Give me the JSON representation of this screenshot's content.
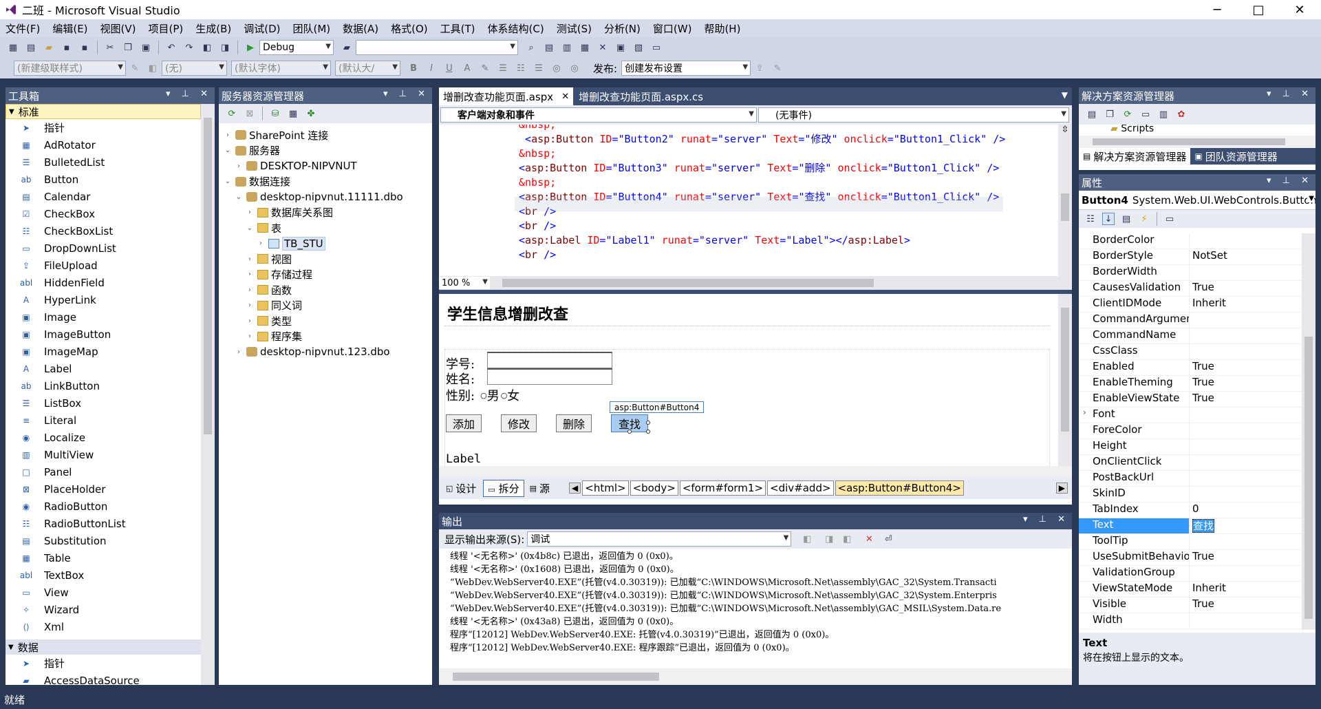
{
  "title": "二班 - Microsoft Visual Studio",
  "window_controls": {
    "minimize": "─",
    "maximize": "□",
    "close": "✕"
  },
  "menu": [
    "文件(F)",
    "编辑(E)",
    "视图(V)",
    "项目(P)",
    "生成(B)",
    "调试(D)",
    "团队(M)",
    "数据(A)",
    "格式(O)",
    "工具(T)",
    "体系结构(C)",
    "测试(S)",
    "分析(N)",
    "窗口(W)",
    "帮助(H)"
  ],
  "toolbar1": {
    "config": "Debug"
  },
  "toolbar2": {
    "style": "(新建级联样式)",
    "block": "(无)",
    "font": "(默认字体)",
    "size": "(默认大/",
    "bold": "B",
    "italic": "I",
    "underline": "U",
    "publish_label": "发布:",
    "publish": "创建发布设置"
  },
  "toolbox": {
    "title": "工具箱",
    "group_standard": "标准",
    "items": [
      {
        "icon": "pointer-icon",
        "glyph": "➤",
        "label": "指针"
      },
      {
        "icon": "adrotator-icon",
        "glyph": "▦",
        "label": "AdRotator"
      },
      {
        "icon": "bulletedlist-icon",
        "glyph": "☰",
        "label": "BulletedList"
      },
      {
        "icon": "button-icon",
        "glyph": "ab",
        "label": "Button"
      },
      {
        "icon": "calendar-icon",
        "glyph": "▤",
        "label": "Calendar"
      },
      {
        "icon": "checkbox-icon",
        "glyph": "☑",
        "label": "CheckBox"
      },
      {
        "icon": "checkboxlist-icon",
        "glyph": "☷",
        "label": "CheckBoxList"
      },
      {
        "icon": "dropdownlist-icon",
        "glyph": "▭",
        "label": "DropDownList"
      },
      {
        "icon": "fileupload-icon",
        "glyph": "⇪",
        "label": "FileUpload"
      },
      {
        "icon": "hiddenfield-icon",
        "glyph": "abl",
        "label": "HiddenField"
      },
      {
        "icon": "hyperlink-icon",
        "glyph": "A",
        "label": "HyperLink"
      },
      {
        "icon": "image-icon",
        "glyph": "▣",
        "label": "Image"
      },
      {
        "icon": "imagebutton-icon",
        "glyph": "▣",
        "label": "ImageButton"
      },
      {
        "icon": "imagemap-icon",
        "glyph": "▣",
        "label": "ImageMap"
      },
      {
        "icon": "label-icon",
        "glyph": "A",
        "label": "Label"
      },
      {
        "icon": "linkbutton-icon",
        "glyph": "ab",
        "label": "LinkButton"
      },
      {
        "icon": "listbox-icon",
        "glyph": "☰",
        "label": "ListBox"
      },
      {
        "icon": "literal-icon",
        "glyph": "≡",
        "label": "Literal"
      },
      {
        "icon": "localize-icon",
        "glyph": "◉",
        "label": "Localize"
      },
      {
        "icon": "multiview-icon",
        "glyph": "▥",
        "label": "MultiView"
      },
      {
        "icon": "panel-icon",
        "glyph": "□",
        "label": "Panel"
      },
      {
        "icon": "placeholder-icon",
        "glyph": "⊠",
        "label": "PlaceHolder"
      },
      {
        "icon": "radiobutton-icon",
        "glyph": "◉",
        "label": "RadioButton"
      },
      {
        "icon": "radiobuttonlist-icon",
        "glyph": "☷",
        "label": "RadioButtonList"
      },
      {
        "icon": "substitution-icon",
        "glyph": "▤",
        "label": "Substitution"
      },
      {
        "icon": "table-icon",
        "glyph": "▦",
        "label": "Table"
      },
      {
        "icon": "textbox-icon",
        "glyph": "abl",
        "label": "TextBox"
      },
      {
        "icon": "view-icon",
        "glyph": "▭",
        "label": "View"
      },
      {
        "icon": "wizard-icon",
        "glyph": "✧",
        "label": "Wizard"
      },
      {
        "icon": "xml-icon",
        "glyph": "⟨⟩",
        "label": "Xml"
      }
    ],
    "group_data": "数据",
    "data_items": [
      {
        "icon": "pointer-icon",
        "glyph": "➤",
        "label": "指针"
      },
      {
        "icon": "accessdatasource-icon",
        "glyph": "▰",
        "label": "AccessDataSource"
      }
    ]
  },
  "server_explorer": {
    "title": "服务器资源管理器",
    "nodes": [
      {
        "indent": 0,
        "exp": "›",
        "icon": "sharepoint-icon",
        "label": "SharePoint 连接"
      },
      {
        "indent": 0,
        "exp": "⌄",
        "icon": "server-icon",
        "label": "服务器"
      },
      {
        "indent": 1,
        "exp": "›",
        "icon": "computer-icon",
        "label": "DESKTOP-NIPVNUT"
      },
      {
        "indent": 0,
        "exp": "⌄",
        "icon": "dataconnection-icon",
        "label": "数据连接"
      },
      {
        "indent": 1,
        "exp": "⌄",
        "icon": "database-icon",
        "label": "desktop-nipvnut.11111.dbo"
      },
      {
        "indent": 2,
        "exp": "›",
        "icon": "folder-icon",
        "label": "数据库关系图"
      },
      {
        "indent": 2,
        "exp": "⌄",
        "icon": "folder-icon",
        "label": "表"
      },
      {
        "indent": 3,
        "exp": "›",
        "icon": "table-icon",
        "label": "TB_STU",
        "selected": true
      },
      {
        "indent": 2,
        "exp": "›",
        "icon": "folder-icon",
        "label": "视图"
      },
      {
        "indent": 2,
        "exp": "›",
        "icon": "folder-icon",
        "label": "存储过程"
      },
      {
        "indent": 2,
        "exp": "›",
        "icon": "folder-icon",
        "label": "函数"
      },
      {
        "indent": 2,
        "exp": "›",
        "icon": "folder-icon",
        "label": "同义词"
      },
      {
        "indent": 2,
        "exp": "›",
        "icon": "folder-icon",
        "label": "类型"
      },
      {
        "indent": 2,
        "exp": "›",
        "icon": "folder-icon",
        "label": "程序集"
      },
      {
        "indent": 1,
        "exp": "›",
        "icon": "database-icon",
        "label": "desktop-nipvnut.123.dbo"
      }
    ]
  },
  "editor": {
    "tab_active": "增删改查功能页面.aspx",
    "tab_inactive": "增删改查功能页面.aspx.cs",
    "object_combo": "客户端对象和事件",
    "event_combo": "(无事件)",
    "code": [
      [
        {
          "c": "c-ent",
          "t": "&nbsp;"
        }
      ],
      [
        {
          "c": "",
          "t": " "
        },
        {
          "c": "c-bl",
          "t": "<"
        },
        {
          "c": "c-tag",
          "t": "asp:Button"
        },
        {
          "c": "c-attr",
          "t": " ID"
        },
        {
          "c": "c-bl",
          "t": "=\"Button2\""
        },
        {
          "c": "c-attr",
          "t": " runat"
        },
        {
          "c": "c-bl",
          "t": "=\"server\""
        },
        {
          "c": "c-attr",
          "t": " Text"
        },
        {
          "c": "c-bl",
          "t": "=\"修改\""
        },
        {
          "c": "c-attr",
          "t": " onclick"
        },
        {
          "c": "c-bl",
          "t": "=\"Button1_Click\" />"
        }
      ],
      [
        {
          "c": "c-ent",
          "t": "&nbsp;"
        }
      ],
      [
        {
          "c": "c-bl",
          "t": "<"
        },
        {
          "c": "c-tag",
          "t": "asp:Button"
        },
        {
          "c": "c-attr",
          "t": " ID"
        },
        {
          "c": "c-bl",
          "t": "=\"Button3\""
        },
        {
          "c": "c-attr",
          "t": " runat"
        },
        {
          "c": "c-bl",
          "t": "=\"server\""
        },
        {
          "c": "c-attr",
          "t": " Text"
        },
        {
          "c": "c-bl",
          "t": "=\"删除\""
        },
        {
          "c": "c-attr",
          "t": " onclick"
        },
        {
          "c": "c-bl",
          "t": "=\"Button1_Click\" />"
        }
      ],
      [
        {
          "c": "c-ent",
          "t": "&nbsp;"
        }
      ],
      [
        {
          "c": "c-bl",
          "t": "<"
        },
        {
          "c": "c-tag",
          "t": "asp:Button"
        },
        {
          "c": "c-attr",
          "t": " ID"
        },
        {
          "c": "c-bl",
          "t": "=\"Button4\""
        },
        {
          "c": "c-attr",
          "t": " runat"
        },
        {
          "c": "c-bl",
          "t": "=\"server\""
        },
        {
          "c": "c-attr",
          "t": " Text"
        },
        {
          "c": "c-bl",
          "t": "=\"查找\""
        },
        {
          "c": "c-attr",
          "t": " onclick"
        },
        {
          "c": "c-bl",
          "t": "=\"Button1_Click\" />"
        }
      ],
      [
        {
          "c": "c-bl",
          "t": "<"
        },
        {
          "c": "c-tag",
          "t": "br"
        },
        {
          "c": "c-bl",
          "t": " />"
        }
      ],
      [
        {
          "c": "c-bl",
          "t": "<"
        },
        {
          "c": "c-tag",
          "t": "br"
        },
        {
          "c": "c-bl",
          "t": " />"
        }
      ],
      [
        {
          "c": "c-bl",
          "t": "<"
        },
        {
          "c": "c-tag",
          "t": "asp:Label"
        },
        {
          "c": "c-attr",
          "t": " ID"
        },
        {
          "c": "c-bl",
          "t": "=\"Label1\""
        },
        {
          "c": "c-attr",
          "t": " runat"
        },
        {
          "c": "c-bl",
          "t": "=\"server\""
        },
        {
          "c": "c-attr",
          "t": " Text"
        },
        {
          "c": "c-bl",
          "t": "=\"Label\"></"
        },
        {
          "c": "c-tag",
          "t": "asp:Label"
        },
        {
          "c": "c-bl",
          "t": ">"
        }
      ],
      [
        {
          "c": "c-bl",
          "t": "<"
        },
        {
          "c": "c-tag",
          "t": "br"
        },
        {
          "c": "c-bl",
          "t": " />"
        }
      ]
    ],
    "zoom": "100 %",
    "design": {
      "heading": "学生信息增删改查",
      "label_id": "学号:",
      "label_name": "姓名:",
      "label_gender": "性别:",
      "male": "男",
      "female": "女",
      "btn_add": "添加",
      "btn_edit": "修改",
      "btn_delete": "删除",
      "btn_find": "查找",
      "selected_tag": "asp:Button#Button4",
      "label_text": "Label"
    },
    "views": {
      "design": "设计",
      "split": "拆分",
      "source": "源"
    },
    "breadcrumb": [
      "<html>",
      "<body>",
      "<form#form1>",
      "<div#add>",
      "<asp:Button#Button4>"
    ]
  },
  "output": {
    "title": "输出",
    "source_label": "显示输出来源(S):",
    "source": "调试",
    "lines": [
      "线程 '<无名称>' (0x4b8c) 已退出，返回值为 0 (0x0)。",
      "线程 '<无名称>' (0x1608) 已退出，返回值为 0 (0x0)。",
      "“WebDev.WebServer40.EXE”(托管(v4.0.30319)): 已加载“C:\\WINDOWS\\Microsoft.Net\\assembly\\GAC_32\\System.Transacti",
      "“WebDev.WebServer40.EXE”(托管(v4.0.30319)): 已加载“C:\\WINDOWS\\Microsoft.Net\\assembly\\GAC_32\\System.Enterpris",
      "“WebDev.WebServer40.EXE”(托管(v4.0.30319)): 已加载“C:\\WINDOWS\\Microsoft.Net\\assembly\\GAC_MSIL\\System.Data.re",
      "线程 '<无名称>' (0x43a8) 已退出，返回值为 0 (0x0)。",
      "程序“[12012] WebDev.WebServer40.EXE: 托管(v4.0.30319)”已退出，返回值为 0 (0x0)。",
      "程序“[12012] WebDev.WebServer40.EXE: 程序跟踪”已退出，返回值为 0 (0x0)。"
    ]
  },
  "solution": {
    "title": "解决方案资源管理器",
    "scripts": "Scripts",
    "tab_solution": "解决方案资源管理器",
    "tab_team": "团队资源管理器"
  },
  "properties": {
    "title": "属性",
    "object": "Button4",
    "object_type": "System.Web.UI.WebControls.Button",
    "rows": [
      {
        "n": "BorderColor",
        "v": ""
      },
      {
        "n": "BorderStyle",
        "v": "NotSet"
      },
      {
        "n": "BorderWidth",
        "v": ""
      },
      {
        "n": "CausesValidation",
        "v": "True"
      },
      {
        "n": "ClientIDMode",
        "v": "Inherit"
      },
      {
        "n": "CommandArgument",
        "v": ""
      },
      {
        "n": "CommandName",
        "v": ""
      },
      {
        "n": "CssClass",
        "v": ""
      },
      {
        "n": "Enabled",
        "v": "True"
      },
      {
        "n": "EnableTheming",
        "v": "True"
      },
      {
        "n": "EnableViewState",
        "v": "True"
      },
      {
        "n": "Font",
        "v": "",
        "exp": true
      },
      {
        "n": "ForeColor",
        "v": ""
      },
      {
        "n": "Height",
        "v": ""
      },
      {
        "n": "OnClientClick",
        "v": ""
      },
      {
        "n": "PostBackUrl",
        "v": ""
      },
      {
        "n": "SkinID",
        "v": ""
      },
      {
        "n": "TabIndex",
        "v": "0"
      },
      {
        "n": "Text",
        "v": "查找",
        "sel": true
      },
      {
        "n": "ToolTip",
        "v": ""
      },
      {
        "n": "UseSubmitBehavior",
        "v": "True"
      },
      {
        "n": "ValidationGroup",
        "v": ""
      },
      {
        "n": "ViewStateMode",
        "v": "Inherit"
      },
      {
        "n": "Visible",
        "v": "True"
      },
      {
        "n": "Width",
        "v": ""
      }
    ],
    "desc_title": "Text",
    "desc": "将在按钮上显示的文本。"
  },
  "status": "就绪"
}
